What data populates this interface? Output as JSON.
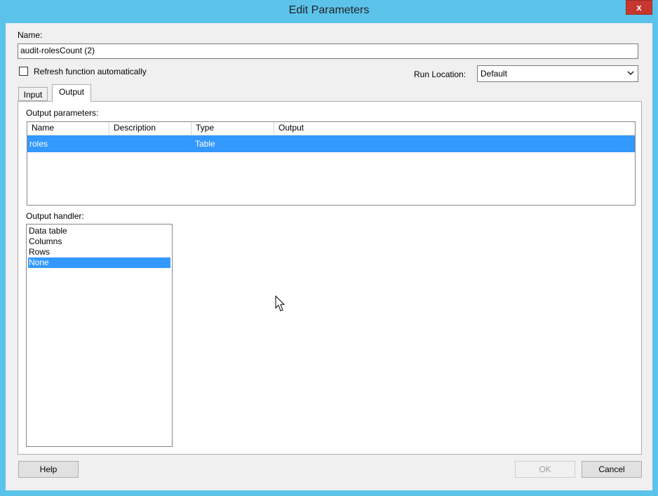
{
  "window": {
    "title": "Edit Parameters",
    "close_label": "x"
  },
  "form": {
    "name_label": "Name:",
    "name_value": "audit-rolesCount (2)",
    "refresh_label": "Refresh function automatically",
    "refresh_checked": false,
    "run_location_label": "Run Location:",
    "run_location_value": "Default"
  },
  "tabs": [
    {
      "label": "Input",
      "active": false
    },
    {
      "label": "Output",
      "active": true
    }
  ],
  "output": {
    "params_label": "Output parameters:",
    "columns": [
      "Name",
      "Description",
      "Type",
      "Output"
    ],
    "rows": [
      {
        "name": "roles",
        "description": "",
        "type": "Table",
        "output": "",
        "selected": true
      }
    ],
    "handler_label": "Output handler:",
    "handlers": [
      {
        "label": "Data table",
        "selected": false
      },
      {
        "label": "Columns",
        "selected": false
      },
      {
        "label": "Rows",
        "selected": false
      },
      {
        "label": "None",
        "selected": true
      }
    ]
  },
  "buttons": {
    "help": "Help",
    "ok": "OK",
    "ok_enabled": false,
    "cancel": "Cancel"
  },
  "colors": {
    "titlebar": "#5bc3ea",
    "selection": "#3399ff",
    "close": "#c7372f"
  }
}
